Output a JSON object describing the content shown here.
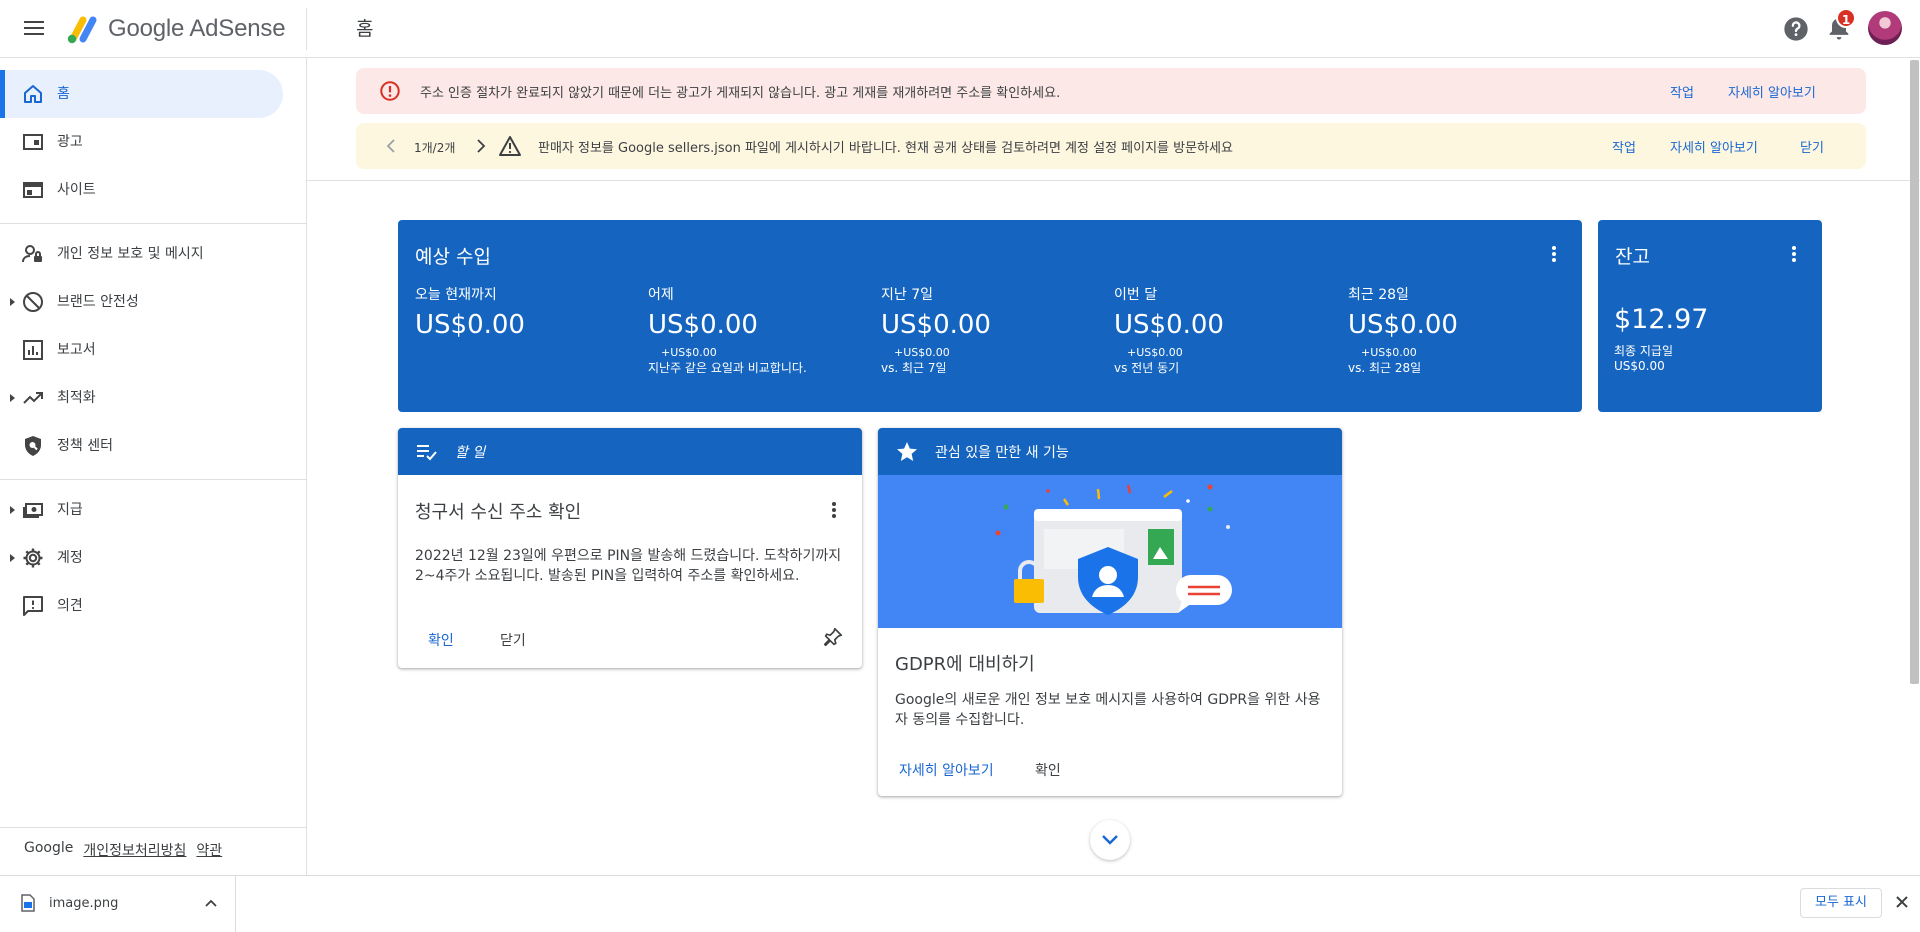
{
  "header": {
    "product_name": "Google AdSense",
    "page_title": "홈",
    "notification_count": "1"
  },
  "sidebar": {
    "items": [
      {
        "label": "홈",
        "icon": "home-icon",
        "active": true
      },
      {
        "label": "광고",
        "icon": "ads-icon"
      },
      {
        "label": "사이트",
        "icon": "sites-icon"
      },
      {
        "label": "개인 정보 보호 및 메시지",
        "icon": "privacy-messaging-icon"
      },
      {
        "label": "브랜드 안전성",
        "icon": "block-icon"
      },
      {
        "label": "보고서",
        "icon": "bar-chart-icon"
      },
      {
        "label": "최적화",
        "icon": "trending-up-icon"
      },
      {
        "label": "정책 센터",
        "icon": "policy-shield-icon"
      },
      {
        "label": "지급",
        "icon": "payments-icon"
      },
      {
        "label": "계정",
        "icon": "gear-icon"
      },
      {
        "label": "의견",
        "icon": "feedback-icon"
      }
    ],
    "footer": {
      "brand": "Google",
      "privacy": "개인정보처리방침",
      "terms": "약관"
    }
  },
  "alerts": {
    "address": {
      "text": "주소 인증 절차가 완료되지 않았기 때문에 더는 광고가 게재되지 않습니다. 광고 게재를 재개하려면 주소를 확인하세요.",
      "action": "작업",
      "learn_more": "자세히 알아보기"
    },
    "sellers": {
      "pager": "1개/2개",
      "text": "판매자 정보를 Google sellers.json 파일에 게시하시기 바랍니다. 현재 공개 상태를 검토하려면 계정 설정 페이지를 방문하세요",
      "action": "작업",
      "learn_more": "자세히 알아보기",
      "dismiss": "닫기"
    }
  },
  "earnings": {
    "title": "예상 수입",
    "stats": [
      {
        "label": "오늘 현재까지",
        "value": "US$0.00",
        "delta": "",
        "compare": ""
      },
      {
        "label": "어제",
        "value": "US$0.00",
        "delta": "+US$0.00",
        "compare": "지난주 같은 요일과 비교합니다."
      },
      {
        "label": "지난 7일",
        "value": "US$0.00",
        "delta": "+US$0.00",
        "compare": "vs. 최근 7일"
      },
      {
        "label": "이번 달",
        "value": "US$0.00",
        "delta": "+US$0.00",
        "compare": "vs 전년 동기"
      },
      {
        "label": "최근 28일",
        "value": "US$0.00",
        "delta": "+US$0.00",
        "compare": "vs. 최근 28일"
      }
    ]
  },
  "balance": {
    "title": "잔고",
    "amount": "$12.97",
    "last_payment_label": "최종 지급일",
    "last_payment_value": "US$0.00"
  },
  "todo": {
    "header": "할 일",
    "title": "청구서 수신 주소 확인",
    "body": "2022년 12월 23일에 우편으로 PIN을 발송해 드렸습니다. 도착하기까지 2~4주가 소요됩니다. 발송된 PIN을 입력하여 주소를 확인하세요.",
    "confirm": "확인",
    "dismiss": "닫기"
  },
  "feature": {
    "header": "관심 있을 만한 새 기능",
    "title": "GDPR에 대비하기",
    "body": "Google의 새로운 개인 정보 보호 메시지를 사용하여 GDPR을 위한 사용자 동의를 수집합니다.",
    "learn_more": "자세히 알아보기",
    "confirm": "확인"
  },
  "downloads": {
    "file_name": "image.png",
    "show_all": "모두 표시"
  },
  "colors": {
    "brand_blue": "#1565c0",
    "link_blue": "#1967d2",
    "error_bg": "#fce8e6",
    "warning_bg": "#fef7e0",
    "active_nav_bg": "#e8f0fe"
  }
}
